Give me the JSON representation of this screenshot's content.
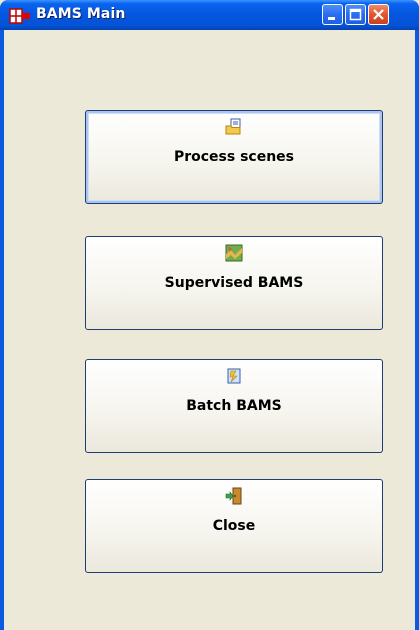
{
  "window": {
    "title": "BAMS Main"
  },
  "title_buttons": {
    "minimize_icon": "minimize-icon",
    "maximize_icon": "maximize-icon",
    "close_icon": "close-icon"
  },
  "buttons": [
    {
      "label": "Process scenes",
      "icon": "folder-document-icon"
    },
    {
      "label": "Supervised BAMS",
      "icon": "map-icon"
    },
    {
      "label": "Batch BAMS",
      "icon": "batch-script-icon"
    },
    {
      "label": "Close",
      "icon": "exit-door-icon"
    }
  ],
  "colors": {
    "titlebar": "#0453d6",
    "client_bg": "#ece9d8",
    "close_button": "#e3552c",
    "button_border": "#1f3d72"
  }
}
